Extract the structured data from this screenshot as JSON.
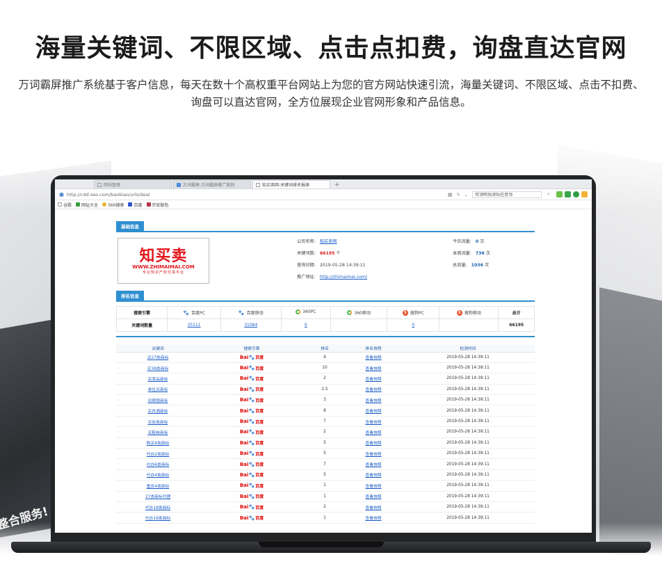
{
  "hero": {
    "title": "海量关键词、不限区域、点击点扣费，询盘直达官网",
    "description": "万词霸屏推广系统基于客户信息，每天在数十个高权重平台网站上为您的官方网站快速引流，海量关键词、不限区域、点击不扣费、询盘可以直达官网，全方位展现企业官网形象和产品信息。"
  },
  "background": {
    "panel_text": "整合服务!"
  },
  "browser": {
    "tabs": [
      {
        "label": "网站管理",
        "active": false
      },
      {
        "label": "万词霸屏-万词霸屏推广案例",
        "active": false
      },
      {
        "label": "知买卖网-关键词排名报表",
        "active": true
      }
    ],
    "new_tab": "+",
    "address": "http://cdd seo.com/baobiao/urls/deal",
    "search_placeholder": "挥洒鸭独津贴任意领",
    "bookmarks": [
      "谷歌",
      "网址大全",
      "360搜索",
      "百度",
      "宗安配色"
    ]
  },
  "basic_info": {
    "section_label": "基础信息",
    "logo": {
      "main": "知买卖",
      "url": "WWW.ZHIMAIMAI.COM",
      "tagline": "专业知识产权交易平台"
    },
    "company_label": "公司名称:",
    "company_value": "知买卖网",
    "keywords_label": "关键词数:",
    "keywords_value": "66195",
    "keywords_unit": "个",
    "date_label": "查询日期:",
    "date_value": "2019-05-28 14:39:11",
    "url_label": "推广地址:",
    "url_value": "http://zhimaimai.com/",
    "today_label": "今日流量:",
    "today_value": "0",
    "today_unit": "次",
    "week_label": "本周流量:",
    "week_value": "736",
    "week_unit": "次",
    "total_label": "总流量:",
    "total_value": "1036",
    "total_unit": "次"
  },
  "rank_info": {
    "section_label": "排名信息",
    "header_engine": "搜索引擎",
    "header_count": "关键词数量",
    "engines": [
      {
        "name": "百度PC",
        "icon": "baidu-icon",
        "count": "35111"
      },
      {
        "name": "百度移动",
        "icon": "baidu-icon",
        "count": "31084"
      },
      {
        "name": "360PC",
        "icon": "360-icon",
        "count": "0"
      },
      {
        "name": "360移动",
        "icon": "360-icon",
        "count": ""
      },
      {
        "name": "搜狗PC",
        "icon": "sogou-icon",
        "count": "0"
      },
      {
        "name": "搜狗移动",
        "icon": "sogou-icon",
        "count": ""
      }
    ],
    "total_label": "总计",
    "total_value": "66195"
  },
  "keyword_table": {
    "headers": [
      "关键词",
      "搜索引擎",
      "排名",
      "排名快照",
      "检测时间"
    ],
    "engine_logo": {
      "part1": "Bai",
      "part2": "百度"
    },
    "rows": [
      {
        "keyword": "买27类商标",
        "rank": "4",
        "snapshot": "查看快照",
        "time": "2019-05-28 14:39:11"
      },
      {
        "keyword": "买38类商标",
        "rank": "10",
        "snapshot": "查看快照",
        "time": "2019-05-28 14:39:11"
      },
      {
        "keyword": "买漆品商标",
        "rank": "2",
        "snapshot": "查看快照",
        "time": "2019-05-28 14:39:11"
      },
      {
        "keyword": "单位买商标",
        "rank": "2.5",
        "snapshot": "查看快照",
        "time": "2019-05-28 14:39:11"
      },
      {
        "keyword": "买眼镜商标",
        "rank": "3",
        "snapshot": "查看快照",
        "time": "2019-05-28 14:39:11"
      },
      {
        "keyword": "买白酒商标",
        "rank": "8",
        "snapshot": "查看快照",
        "time": "2019-05-28 14:39:11"
      },
      {
        "keyword": "买妆类商标",
        "rank": "7",
        "snapshot": "查看快照",
        "time": "2019-05-28 14:39:11"
      },
      {
        "keyword": "买鞋袜商标",
        "rank": "2",
        "snapshot": "查看快照",
        "time": "2019-05-28 14:39:11"
      },
      {
        "keyword": "购买4类商标",
        "rank": "5",
        "snapshot": "查看快照",
        "time": "2019-05-28 14:39:11"
      },
      {
        "keyword": "代办2类商标",
        "rank": "5",
        "snapshot": "查看快照",
        "time": "2019-05-28 14:39:11"
      },
      {
        "keyword": "代办6类商标",
        "rank": "7",
        "snapshot": "查看快照",
        "time": "2019-05-28 14:39:11"
      },
      {
        "keyword": "代办4类商标",
        "rank": "5",
        "snapshot": "查看快照",
        "time": "2019-05-28 14:39:11"
      },
      {
        "keyword": "重庆4类商标",
        "rank": "1",
        "snapshot": "查看快照",
        "time": "2019-05-28 14:39:11"
      },
      {
        "keyword": "27类商标代理",
        "rank": "1",
        "snapshot": "查看快照",
        "time": "2019-05-28 14:39:11"
      },
      {
        "keyword": "代办18类商标",
        "rank": "2",
        "snapshot": "查看快照",
        "time": "2019-05-28 14:39:11"
      },
      {
        "keyword": "代办16类商标",
        "rank": "1",
        "snapshot": "查看快照",
        "time": "2019-05-28 14:39:11"
      }
    ]
  }
}
